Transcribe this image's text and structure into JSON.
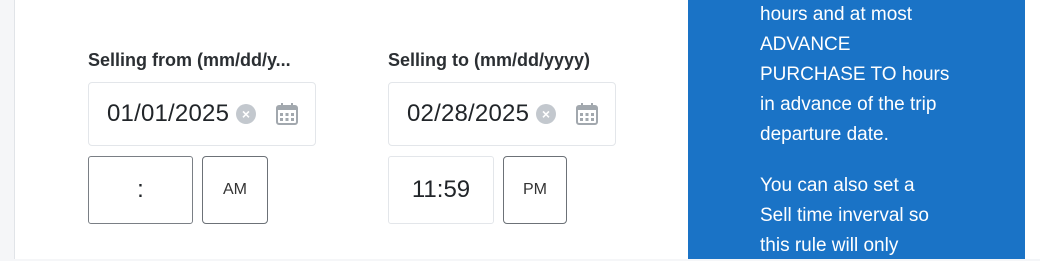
{
  "from": {
    "label": "Selling from (mm/dd/y...",
    "date": "01/01/2025",
    "time": ":",
    "ampm": "AM"
  },
  "to": {
    "label": "Selling to (mm/dd/yyyy)",
    "date": "02/28/2025",
    "time": "11:59",
    "ampm": "PM"
  },
  "info": {
    "lines_p1": [
      "hours and at most",
      "ADVANCE",
      "PURCHASE TO hours",
      "in advance of the trip",
      "departure date."
    ],
    "lines_p2": [
      "You can also set a",
      "Sell time inverval so",
      "this rule will only"
    ]
  },
  "icons": {
    "clear": "close-circle-icon",
    "calendar": "calendar-icon"
  },
  "colors": {
    "info_bg": "#1a73c6",
    "clear_icon": "#c3c8ce",
    "calendar_icon": "#a2a8ae"
  }
}
